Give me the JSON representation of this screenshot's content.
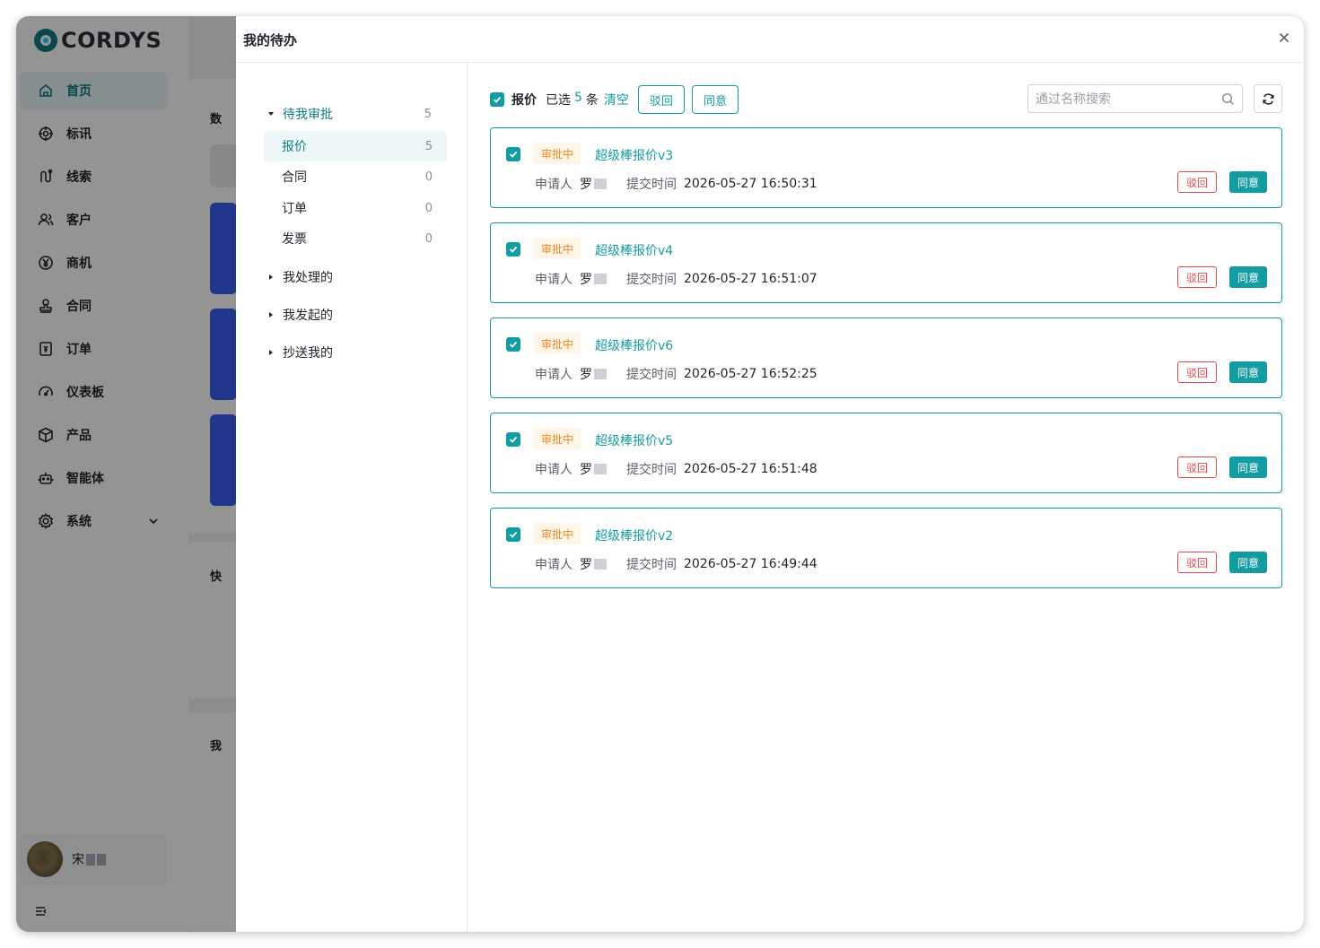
{
  "app": {
    "brand": "CORDYS",
    "nav": [
      {
        "label": "首页",
        "icon": "home-icon"
      },
      {
        "label": "标讯",
        "icon": "target-icon"
      },
      {
        "label": "线索",
        "icon": "route-icon"
      },
      {
        "label": "客户",
        "icon": "users-icon"
      },
      {
        "label": "商机",
        "icon": "yen-icon"
      },
      {
        "label": "合同",
        "icon": "stamp-icon"
      },
      {
        "label": "订单",
        "icon": "order-icon"
      },
      {
        "label": "仪表板",
        "icon": "gauge-icon"
      },
      {
        "label": "产品",
        "icon": "box-icon"
      },
      {
        "label": "智能体",
        "icon": "robot-icon"
      },
      {
        "label": "系统",
        "icon": "settings-icon"
      }
    ],
    "user": {
      "name": "宋"
    },
    "background_labels": {
      "a": "数",
      "b": "快",
      "c": "我"
    }
  },
  "drawer": {
    "title": "我的待办",
    "tree": {
      "pending": {
        "label": "待我审批",
        "count": "5"
      },
      "children": [
        {
          "label": "报价",
          "count": "5"
        },
        {
          "label": "合同",
          "count": "0"
        },
        {
          "label": "订单",
          "count": "0"
        },
        {
          "label": "发票",
          "count": "0"
        }
      ],
      "handled": {
        "label": "我处理的"
      },
      "initiated": {
        "label": "我发起的"
      },
      "cc": {
        "label": "抄送我的"
      }
    },
    "toolbar": {
      "category": "报价",
      "selected_prefix": "已选",
      "selected_count": "5",
      "selected_suffix": "条",
      "clear": "清空",
      "reject": "驳回",
      "agree": "同意",
      "search_placeholder": "通过名称搜索"
    },
    "items": [
      {
        "status": "审批中",
        "name": "超级棒报价v3",
        "applicant_label": "申请人",
        "applicant": "罗",
        "time_label": "提交时间",
        "time": "2026-05-27 16:50:31",
        "reject": "驳回",
        "agree": "同意"
      },
      {
        "status": "审批中",
        "name": "超级棒报价v4",
        "applicant_label": "申请人",
        "applicant": "罗",
        "time_label": "提交时间",
        "time": "2026-05-27 16:51:07",
        "reject": "驳回",
        "agree": "同意"
      },
      {
        "status": "审批中",
        "name": "超级棒报价v6",
        "applicant_label": "申请人",
        "applicant": "罗",
        "time_label": "提交时间",
        "time": "2026-05-27 16:52:25",
        "reject": "驳回",
        "agree": "同意"
      },
      {
        "status": "审批中",
        "name": "超级棒报价v5",
        "applicant_label": "申请人",
        "applicant": "罗",
        "time_label": "提交时间",
        "time": "2026-05-27 16:51:48",
        "reject": "驳回",
        "agree": "同意"
      },
      {
        "status": "审批中",
        "name": "超级棒报价v2",
        "applicant_label": "申请人",
        "applicant": "罗",
        "time_label": "提交时间",
        "time": "2026-05-27 16:49:44",
        "reject": "驳回",
        "agree": "同意"
      }
    ]
  },
  "colors": {
    "accent": "#139ca2",
    "danger": "#e5484d",
    "warning": "#f08a24"
  }
}
